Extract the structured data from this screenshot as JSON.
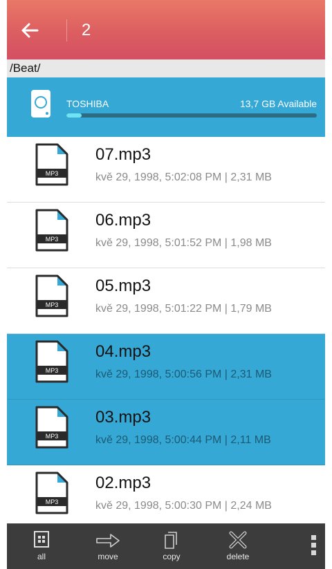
{
  "header": {
    "back_icon": "arrow-left-icon",
    "title": "2",
    "gradient": [
      "#e97867",
      "#d44f63"
    ]
  },
  "path": "/Beat/",
  "storage": {
    "icon": "hard-drive-icon",
    "name": "TOSHIBA",
    "available": "13,7 GB Available",
    "used_fraction": 0.06,
    "accent": "#35a8d5"
  },
  "files": [
    {
      "name": "07.mp3",
      "meta": "kvě 29, 1998, 5:02:08 PM | 2,31 MB",
      "selected": false,
      "icon_label": "MP3"
    },
    {
      "name": "06.mp3",
      "meta": "kvě 29, 1998, 5:01:52 PM | 1,98 MB",
      "selected": false,
      "icon_label": "MP3"
    },
    {
      "name": "05.mp3",
      "meta": "kvě 29, 1998, 5:01:22 PM | 1,79 MB",
      "selected": false,
      "icon_label": "MP3"
    },
    {
      "name": "04.mp3",
      "meta": "kvě 29, 1998, 5:00:56 PM | 2,31 MB",
      "selected": true,
      "icon_label": "MP3"
    },
    {
      "name": "03.mp3",
      "meta": "kvě 29, 1998, 5:00:44 PM | 2,11 MB",
      "selected": true,
      "icon_label": "MP3"
    },
    {
      "name": "02.mp3",
      "meta": "kvě 29, 1998, 5:00:30 PM | 2,24 MB",
      "selected": false,
      "icon_label": "MP3"
    }
  ],
  "toolbar": {
    "all": {
      "label": "all",
      "icon": "select-all-icon"
    },
    "move": {
      "label": "move",
      "icon": "arrow-right-icon"
    },
    "copy": {
      "label": "copy",
      "icon": "copy-icon"
    },
    "delete": {
      "label": "delete",
      "icon": "delete-x-icon"
    },
    "more_icon": "more-vertical-icon"
  }
}
